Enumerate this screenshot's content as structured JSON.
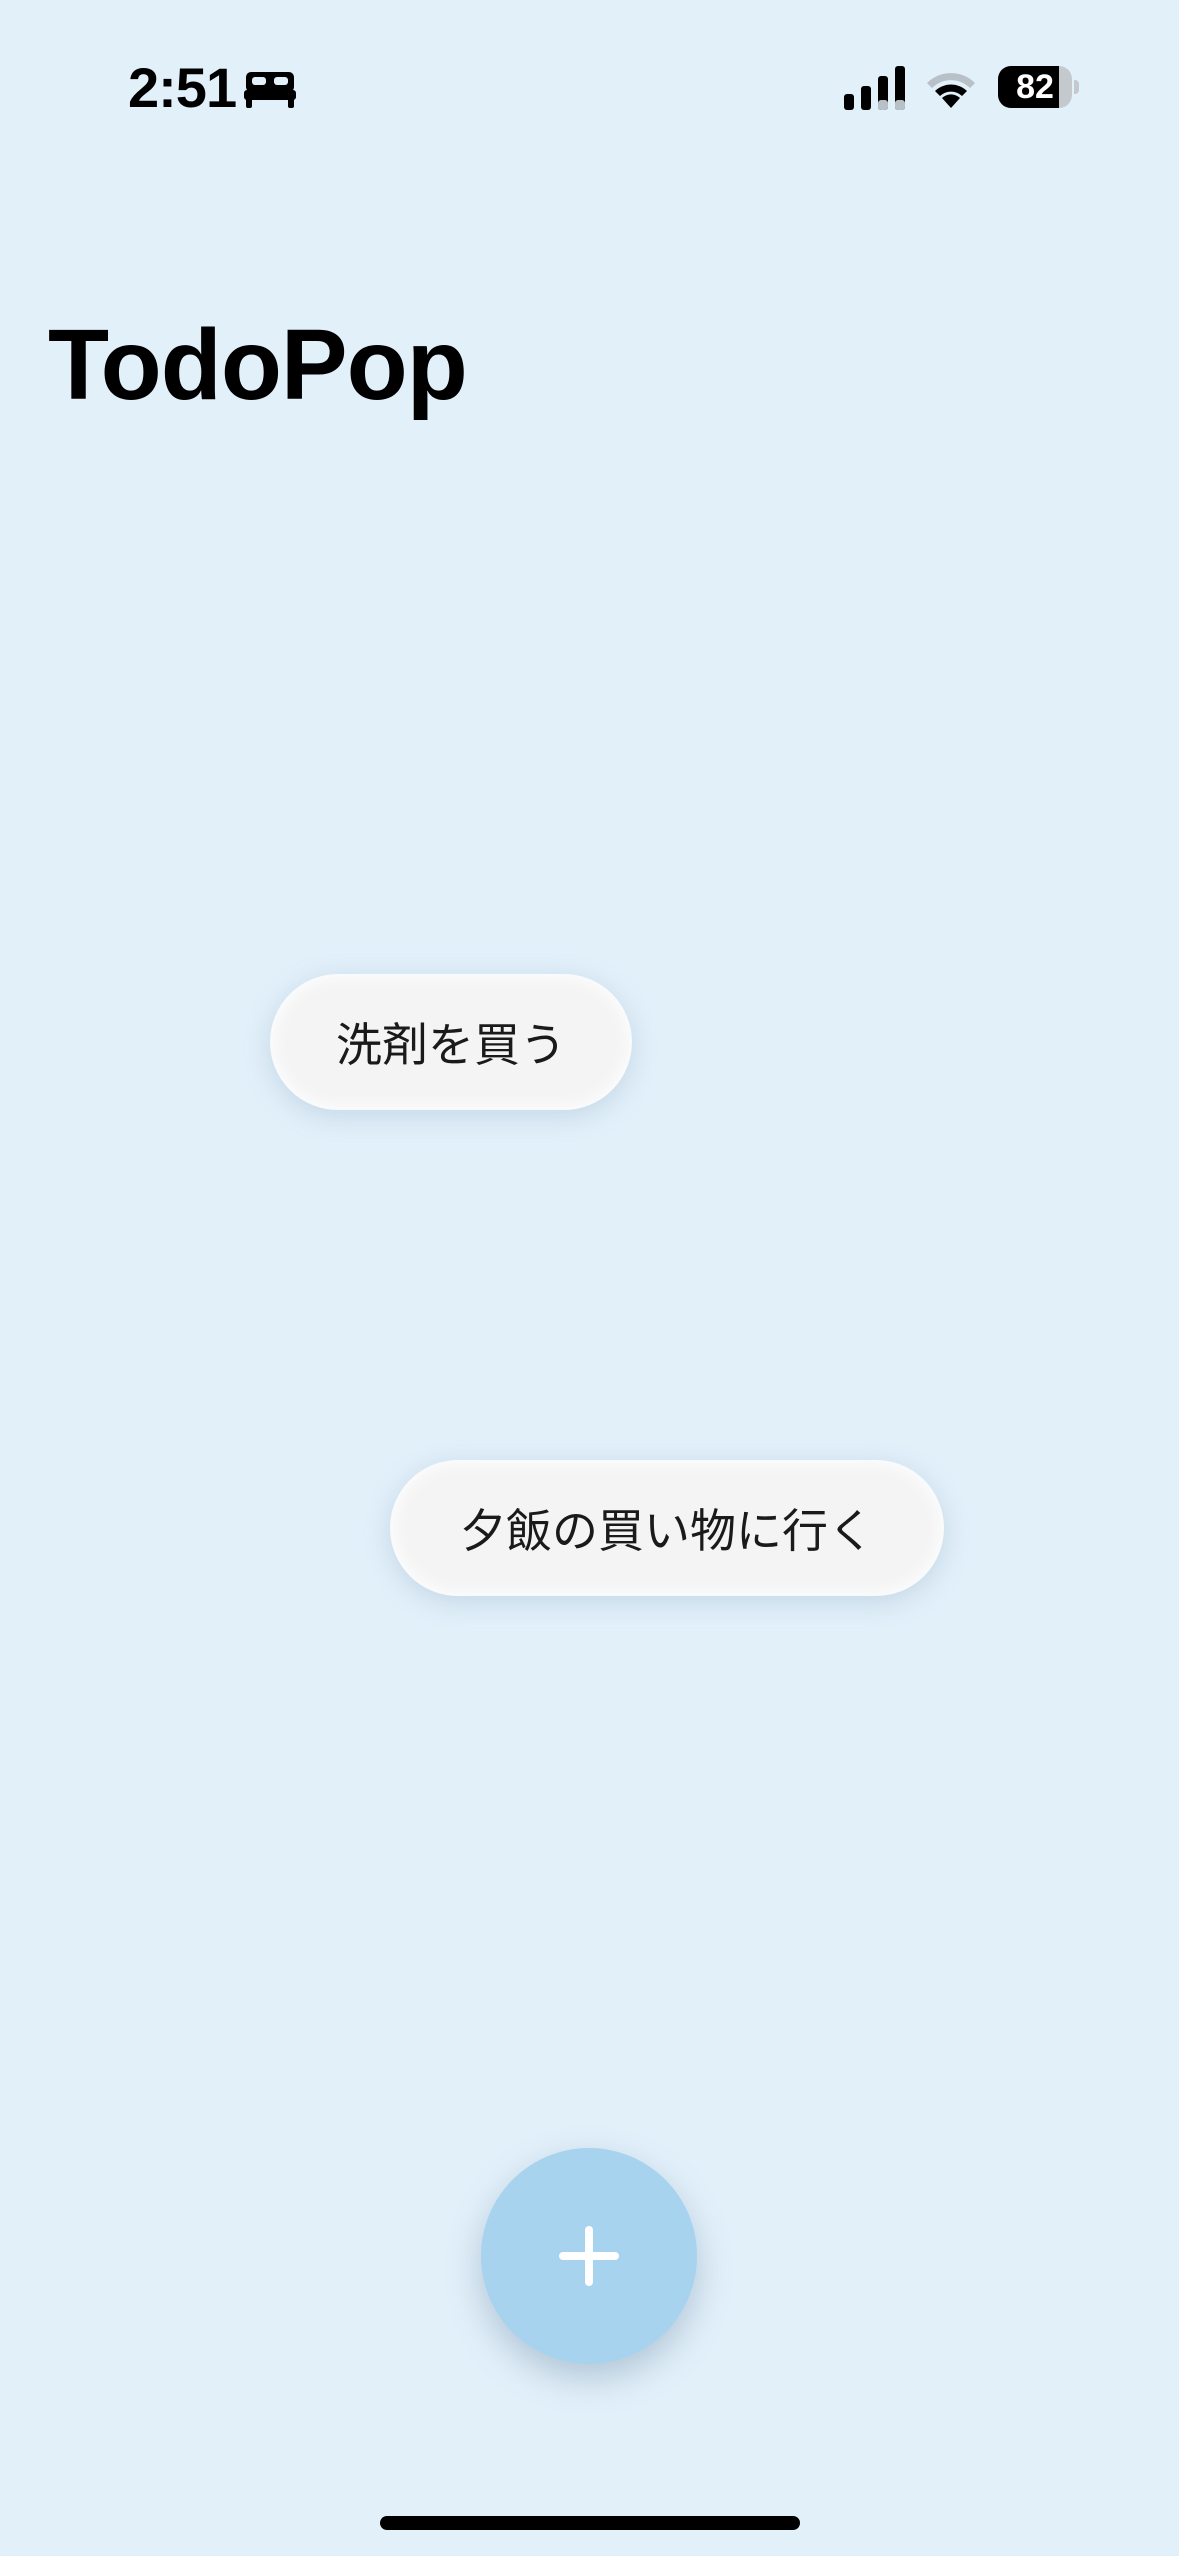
{
  "status_bar": {
    "time": "2:51",
    "focus_icon": "bed-icon",
    "signal_icon": "cellular-signal-icon",
    "wifi_icon": "wifi-icon",
    "battery_percent": "82",
    "battery_level": 0.82
  },
  "header": {
    "title": "TodoPop"
  },
  "todos": [
    {
      "label": "洗剤を買う"
    },
    {
      "label": "夕飯の買い物に行く"
    }
  ],
  "add_button": {
    "icon": "plus-icon"
  },
  "colors": {
    "background": "#e2f0fa",
    "bubble": "#f4f4f5",
    "accent": "#a8d3ef",
    "text": "#000000"
  }
}
